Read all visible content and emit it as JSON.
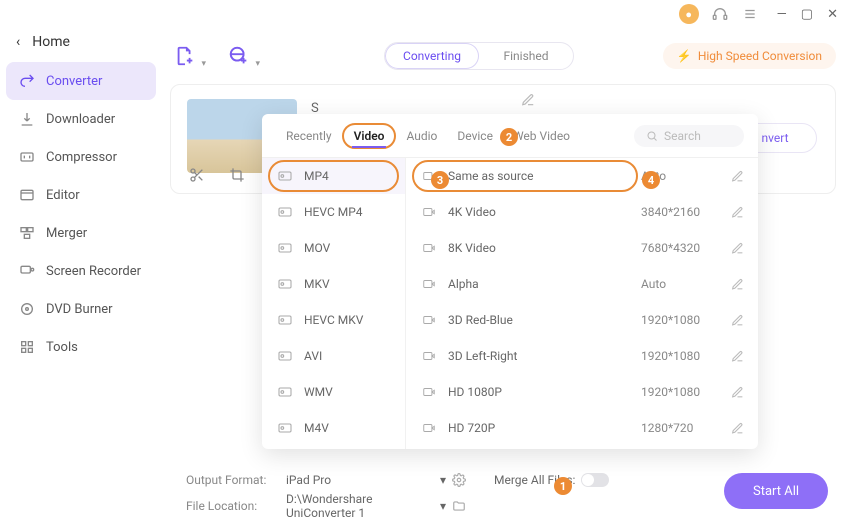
{
  "window": {
    "home_label": "Home"
  },
  "sidebar": {
    "items": [
      {
        "label": "Converter"
      },
      {
        "label": "Downloader"
      },
      {
        "label": "Compressor"
      },
      {
        "label": "Editor"
      },
      {
        "label": "Merger"
      },
      {
        "label": "Screen Recorder"
      },
      {
        "label": "DVD Burner"
      },
      {
        "label": "Tools"
      }
    ]
  },
  "tabs": {
    "converting": "Converting",
    "finished": "Finished"
  },
  "hsc_label": "High Speed Conversion",
  "convert_label": "nvert",
  "panel": {
    "tabs": [
      "Recently",
      "Video",
      "Audio",
      "Device",
      "Web Video"
    ],
    "search_placeholder": "Search",
    "formats": [
      "MP4",
      "HEVC MP4",
      "MOV",
      "MKV",
      "HEVC MKV",
      "AVI",
      "WMV",
      "M4V"
    ],
    "resolutions": [
      {
        "name": "Same as source",
        "val": "Auto"
      },
      {
        "name": "4K Video",
        "val": "3840*2160"
      },
      {
        "name": "8K Video",
        "val": "7680*4320"
      },
      {
        "name": "Alpha",
        "val": "Auto"
      },
      {
        "name": "3D Red-Blue",
        "val": "1920*1080"
      },
      {
        "name": "3D Left-Right",
        "val": "1920*1080"
      },
      {
        "name": "HD 1080P",
        "val": "1920*1080"
      },
      {
        "name": "HD 720P",
        "val": "1280*720"
      }
    ]
  },
  "footer": {
    "output_format_label": "Output Format:",
    "output_format_value": "iPad Pro",
    "merge_label": "Merge All Files:",
    "file_location_label": "File Location:",
    "file_location_value": "D:\\Wondershare UniConverter 1",
    "start_all": "Start All"
  },
  "badges": {
    "b1": "1",
    "b2": "2",
    "b3": "3",
    "b4": "4"
  }
}
